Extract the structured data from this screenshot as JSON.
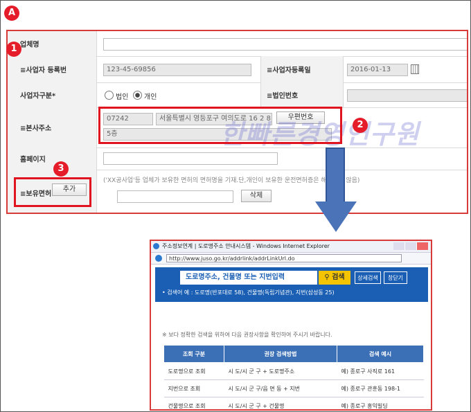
{
  "markers": {
    "a": "A",
    "one": "1",
    "two": "2",
    "three": "3"
  },
  "form": {
    "company_label": "업체명",
    "bizno_label": "≡사업자 등록번",
    "bizno_value": "123-45-69856",
    "bizdate_label": "≡사업자등록일",
    "bizdate_value": "2016-01-13",
    "biztype_label": "사업자구분*",
    "radio_corp": "법인",
    "radio_indiv": "개인",
    "corpno_label": "≡법인번호",
    "addr_label": "≡본사주소",
    "zip_value": "07242",
    "addr_value": "서울특별시 영등포구 여의도로 16 2 8",
    "zip_button": "우편번호",
    "addr_detail": "5층",
    "homepage_label": "홈페이지",
    "license_label": "≡보유면허",
    "add_button": "추가",
    "license_hint": "('XX공사업'등 업체가 보유한 면허의 면허명을 기재.단,개인이 보유한 운전면허증은 해당하지 않음)",
    "delete_button": "삭제"
  },
  "watermark": "한빠른경영연구원",
  "popup": {
    "title": "주소정보연계 | 도로명주소 안내시스템 - Windows Internet Explorer",
    "url": "http://www.juso.go.kr/addrlink/addrLinkUrl.do",
    "search_placeholder": "도로명주소, 건물명 또는 지번입력",
    "search_button": "검색",
    "detail_button": "상세검색",
    "close_button": "창닫기",
    "example": "• 검색어 예 : 도로명(반포대로 58), 건물명(독립기념관), 지번(삼성동 25)",
    "note": "※ 보다 정확한 검색을 위하여 다음 권장사항을 확인하여 주시기 바랍니다.",
    "table": {
      "headers": [
        "조회 구분",
        "권장 검색방법",
        "검색 예시"
      ],
      "rows": [
        [
          "도로명으로 조회",
          "시 도/시 군 구 + 도로명주소",
          "예) 종로구 사직로 161"
        ],
        [
          "지번으로 조회",
          "시 도/시 군 구/읍 면 동 + 지번",
          "예) 종로구 관훈동 198-1"
        ],
        [
          "건물명으로 조회",
          "시 도/시 군 구 + 건물명",
          "예) 종로구 흥익빌딩"
        ]
      ]
    }
  }
}
